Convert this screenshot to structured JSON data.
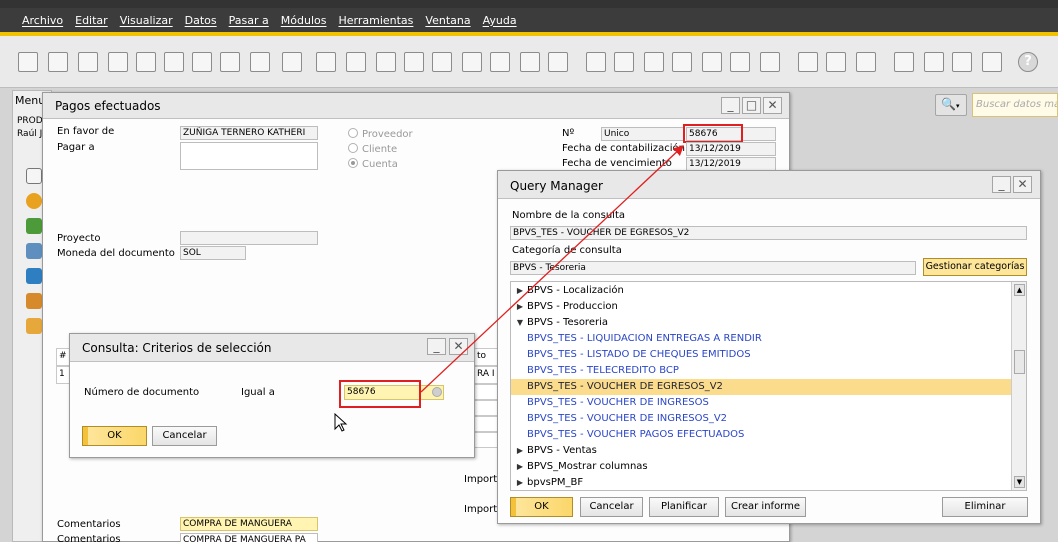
{
  "menubar": [
    "Archivo",
    "Editar",
    "Visualizar",
    "Datos",
    "Pasar a",
    "Módulos",
    "Herramientas",
    "Ventana",
    "Ayuda"
  ],
  "side": {
    "title": "Menu",
    "lines": [
      "PROD",
      "Raúl J"
    ]
  },
  "search": {
    "placeholder": "Buscar datos ma"
  },
  "pagos": {
    "title": "Pagos efectuados",
    "en_favor_label": "En favor de",
    "en_favor_value": "ZUÑIGA TERNERO KATHERI",
    "pagar_a_label": "Pagar a",
    "radio_proveedor": "Proveedor",
    "radio_cliente": "Cliente",
    "radio_cuenta": "Cuenta",
    "proyecto_label": "Proyecto",
    "moneda_label": "Moneda del documento",
    "moneda_value": "SOL",
    "n_label": "Nº",
    "series_value": "Unico",
    "doc_number": "58676",
    "fecha_cont_label": "Fecha de contabilización",
    "fecha_cont_value": "13/12/2019",
    "fecha_venc_label": "Fecha de vencimiento",
    "fecha_venc_value": "13/12/2019",
    "grid_hash": "#",
    "grid_row_1": "1",
    "grid_col_to": "to",
    "grid_cell_ra": "RA I",
    "import_1": "Import",
    "import_2": "Import",
    "comentarios_label": "Comentarios",
    "comentarios_value": "COMPRA DE MANGUERA",
    "comentarios_label_2": "Comentarios",
    "comentarios_value_2": "COMPRA DE MANGUERA PA"
  },
  "consulta": {
    "title": "Consulta: Criterios de selección",
    "numero_label": "Número de documento",
    "igual_label": "Igual a",
    "value": "58676",
    "ok": "OK",
    "cancel": "Cancelar"
  },
  "qm": {
    "title": "Query Manager",
    "name_label": "Nombre de la consulta",
    "name_value": "BPVS_TES - VOUCHER DE EGRESOS_V2",
    "cat_label": "Categoría de consulta",
    "cat_value": "BPVS - Tesoreria",
    "manage_btn": "Gestionar categorías",
    "items": [
      {
        "text": "BPVS - Localización",
        "kind": "cat",
        "arrow": "▶"
      },
      {
        "text": "BPVS - Produccion",
        "kind": "cat",
        "arrow": "▶"
      },
      {
        "text": "BPVS - Tesoreria",
        "kind": "cat",
        "arrow": "▼"
      },
      {
        "text": "BPVS_TES - LIQUIDACION ENTREGAS A RENDIR",
        "kind": "query",
        "arrow": ""
      },
      {
        "text": "BPVS_TES - LISTADO DE CHEQUES EMITIDOS",
        "kind": "query",
        "arrow": ""
      },
      {
        "text": "BPVS_TES - TELECREDITO BCP",
        "kind": "query",
        "arrow": ""
      },
      {
        "text": "BPVS_TES - VOUCHER DE EGRESOS_V2",
        "kind": "selected",
        "arrow": ""
      },
      {
        "text": "BPVS_TES - VOUCHER DE INGRESOS",
        "kind": "query",
        "arrow": ""
      },
      {
        "text": "BPVS_TES - VOUCHER DE INGRESOS_V2",
        "kind": "query",
        "arrow": ""
      },
      {
        "text": "BPVS_TES - VOUCHER PAGOS EFECTUADOS",
        "kind": "query",
        "arrow": ""
      },
      {
        "text": "BPVS - Ventas",
        "kind": "cat",
        "arrow": "▶"
      },
      {
        "text": "BPVS_Mostrar columnas",
        "kind": "cat",
        "arrow": "▶"
      },
      {
        "text": "bpvsPM_BF",
        "kind": "cat",
        "arrow": "▶"
      }
    ],
    "ok": "OK",
    "cancel": "Cancelar",
    "plan": "Planificar",
    "report": "Crear informe",
    "delete": "Eliminar"
  },
  "colors": {
    "accent_yellow": "#f0c200",
    "highlight": "#fbdc8c",
    "query_blue": "#2b46c6",
    "annotation_red": "#e02020"
  }
}
